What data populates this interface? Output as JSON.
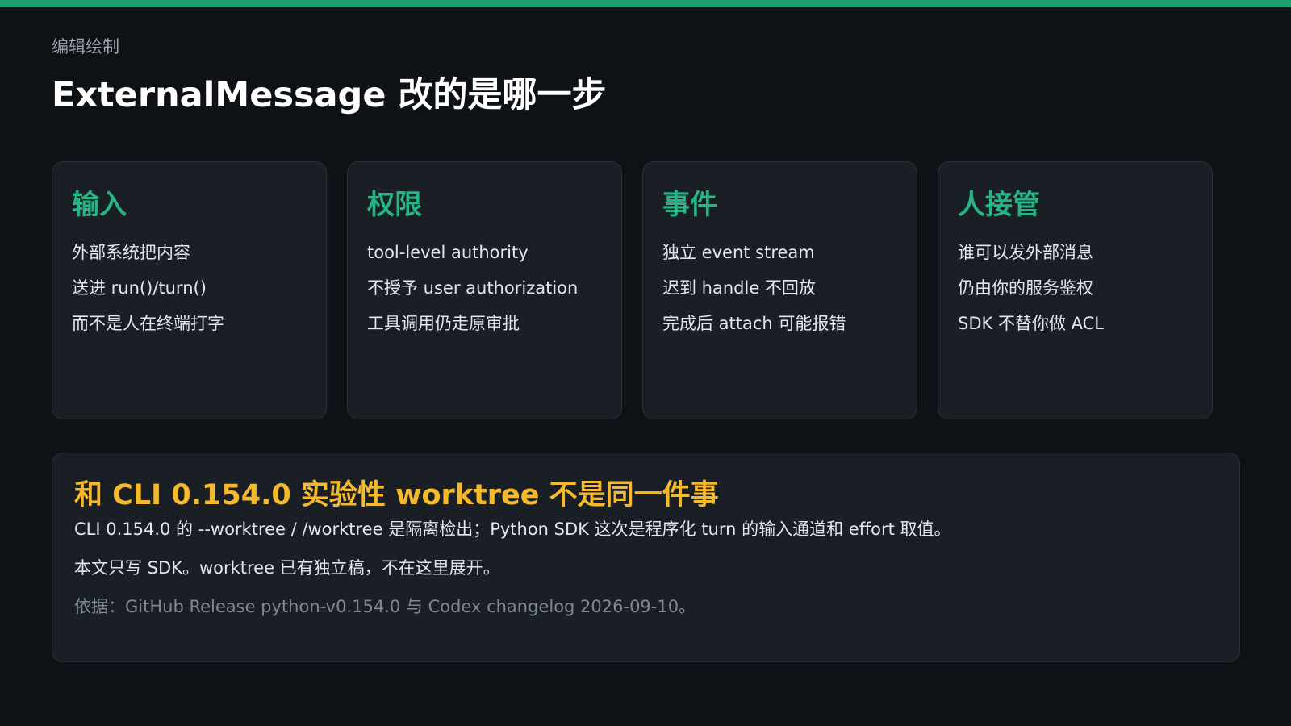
{
  "colors": {
    "background": "#0e1217",
    "accent_bar": "#1f9d73",
    "card_background": "#1a1f26",
    "card_title": "#27b585",
    "note_title": "#f4b92c",
    "body_text": "#e3e7ec",
    "muted_text": "#9aa3ad"
  },
  "header": {
    "eyebrow": "编辑绘制",
    "title": "ExternalMessage 改的是哪一步"
  },
  "cards": [
    {
      "title": "输入",
      "lines": [
        "外部系统把内容",
        "送进 run()/turn()",
        "而不是人在终端打字"
      ]
    },
    {
      "title": "权限",
      "lines": [
        "tool-level authority",
        "不授予 user authorization",
        "工具调用仍走原审批"
      ]
    },
    {
      "title": "事件",
      "lines": [
        "独立 event stream",
        "迟到 handle 不回放",
        "完成后 attach 可能报错"
      ]
    },
    {
      "title": "人接管",
      "lines": [
        "谁可以发外部消息",
        "仍由你的服务鉴权",
        "SDK 不替你做 ACL"
      ]
    }
  ],
  "note": {
    "title": "和 CLI 0.154.0 实验性 worktree 不是同一件事",
    "lines": [
      "CLI 0.154.0 的 --worktree / /worktree 是隔离检出；Python SDK 这次是程序化 turn 的输入通道和 effort 取值。",
      "本文只写 SDK。worktree 已有独立稿，不在这里展开。"
    ],
    "source": "依据：GitHub Release python-v0.154.0 与 Codex changelog 2026-09-10。"
  }
}
